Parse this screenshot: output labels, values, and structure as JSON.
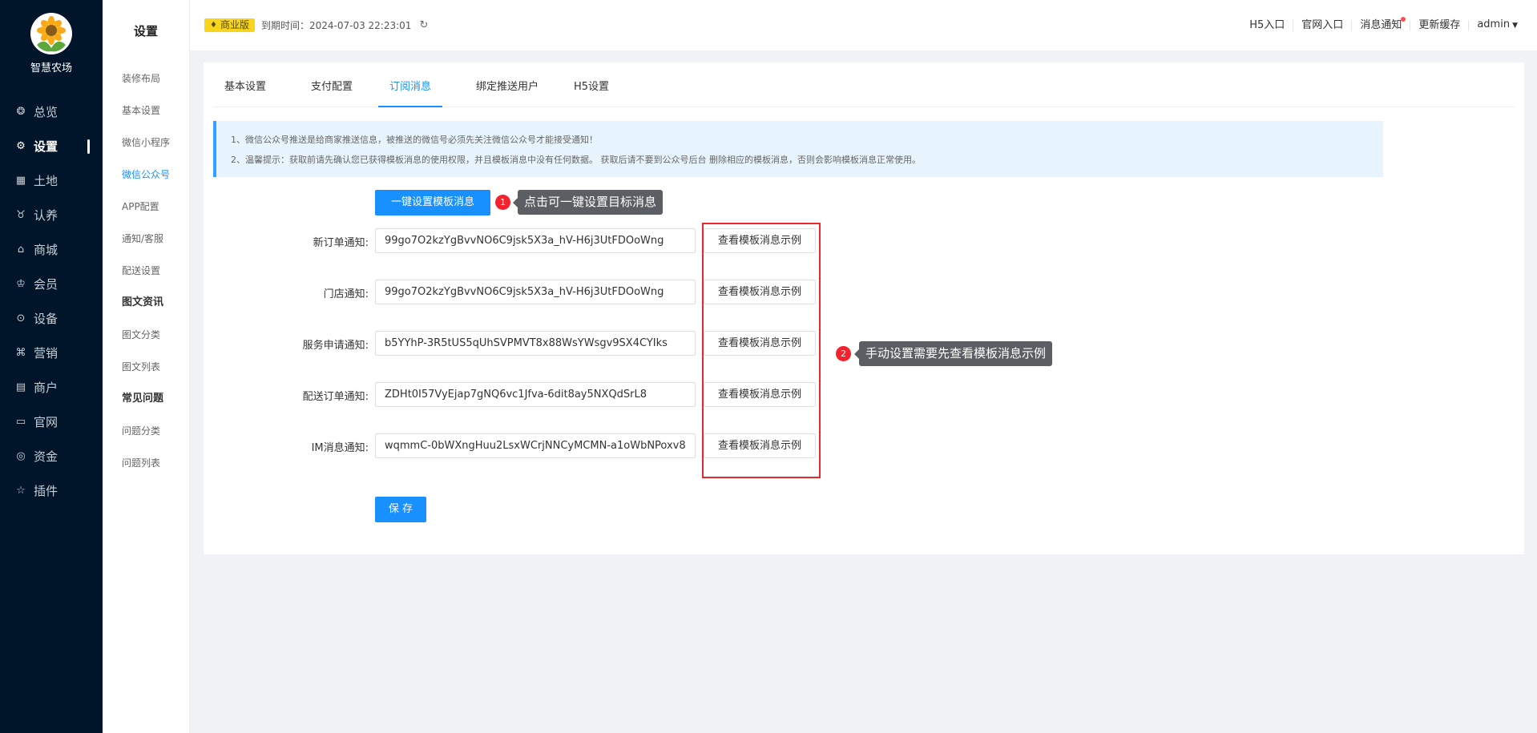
{
  "sidebar": {
    "brand": "智慧农场",
    "items": [
      {
        "label": "总览",
        "icon": "dashboard-icon",
        "glyph": "❂"
      },
      {
        "label": "设置",
        "icon": "gear-icon",
        "glyph": "⚙"
      },
      {
        "label": "土地",
        "icon": "grid-icon",
        "glyph": "▦"
      },
      {
        "label": "认养",
        "icon": "adopt-icon",
        "glyph": "♉"
      },
      {
        "label": "商城",
        "icon": "shop-icon",
        "glyph": "⌂"
      },
      {
        "label": "会员",
        "icon": "member-icon",
        "glyph": "♔"
      },
      {
        "label": "设备",
        "icon": "location-icon",
        "glyph": "⊙"
      },
      {
        "label": "营销",
        "icon": "marketing-icon",
        "glyph": "⌘"
      },
      {
        "label": "商户",
        "icon": "merchant-icon",
        "glyph": "▤"
      },
      {
        "label": "官网",
        "icon": "website-icon",
        "glyph": "▭"
      },
      {
        "label": "资金",
        "icon": "fund-icon",
        "glyph": "◎"
      },
      {
        "label": "插件",
        "icon": "star-icon",
        "glyph": "☆"
      }
    ],
    "active_index": 1
  },
  "subnav": {
    "title": "设置",
    "items": [
      {
        "label": "装修布局",
        "type": "item"
      },
      {
        "label": "基本设置",
        "type": "item"
      },
      {
        "label": "微信小程序",
        "type": "item"
      },
      {
        "label": "微信公众号",
        "type": "active"
      },
      {
        "label": "APP配置",
        "type": "item"
      },
      {
        "label": "通知/客服",
        "type": "item"
      },
      {
        "label": "配送设置",
        "type": "item"
      },
      {
        "label": "图文资讯",
        "type": "group"
      },
      {
        "label": "图文分类",
        "type": "item"
      },
      {
        "label": "图文列表",
        "type": "item"
      },
      {
        "label": "常见问题",
        "type": "group"
      },
      {
        "label": "问题分类",
        "type": "item"
      },
      {
        "label": "问题列表",
        "type": "item"
      }
    ]
  },
  "header": {
    "edition_badge": "商业版",
    "expire_text": "到期时间：2024-07-03 22:23:01",
    "links": [
      "H5入口",
      "官网入口",
      "消息通知",
      "更新缓存"
    ],
    "user": "admin"
  },
  "tabs": {
    "items": [
      "基本设置",
      "支付配置",
      "订阅消息",
      "绑定推送用户",
      "H5设置"
    ],
    "active_index": 2
  },
  "notice": {
    "line1": "1、微信公众号推送是给商家推送信息，被推送的微信号必须先关注微信公众号才能接受通知！",
    "line2": "2、温馨提示：获取前请先确认您已获得模板消息的使用权限，并且模板消息中没有任何数据。 获取后请不要到公众号后台 删除相应的模板消息，否则会影响模板消息正常使用。"
  },
  "form": {
    "auto_button": "一键设置模板消息",
    "example_button": "查看模板消息示例",
    "save_button": "保 存",
    "rows": [
      {
        "label": "新订单通知:",
        "value": "99go7O2kzYgBvvNO6C9jsk5X3a_hV-H6j3UtFDOoWng"
      },
      {
        "label": "门店通知:",
        "value": "99go7O2kzYgBvvNO6C9jsk5X3a_hV-H6j3UtFDOoWng"
      },
      {
        "label": "服务申请通知:",
        "value": "b5YYhP-3R5tUS5qUhSVPMVT8x88WsYWsgv9SX4CYIks"
      },
      {
        "label": "配送订单通知:",
        "value": "ZDHt0I57VyEjap7gNQ6vc1Jfva-6dit8ay5NXQdSrL8"
      },
      {
        "label": "IM消息通知:",
        "value": "wqmmC-0bWXngHuu2LsxWCrjNNCyMCMN-a1oWbNPoxv8"
      }
    ]
  },
  "annotations": {
    "step1_num": "1",
    "step1_text": "点击可一键设置目标消息",
    "step2_num": "2",
    "step2_text": "手动设置需要先查看模板消息示例"
  },
  "colors": {
    "primary": "#1890ff",
    "sidebar": "#001529",
    "annotation_red": "#e8282f"
  }
}
